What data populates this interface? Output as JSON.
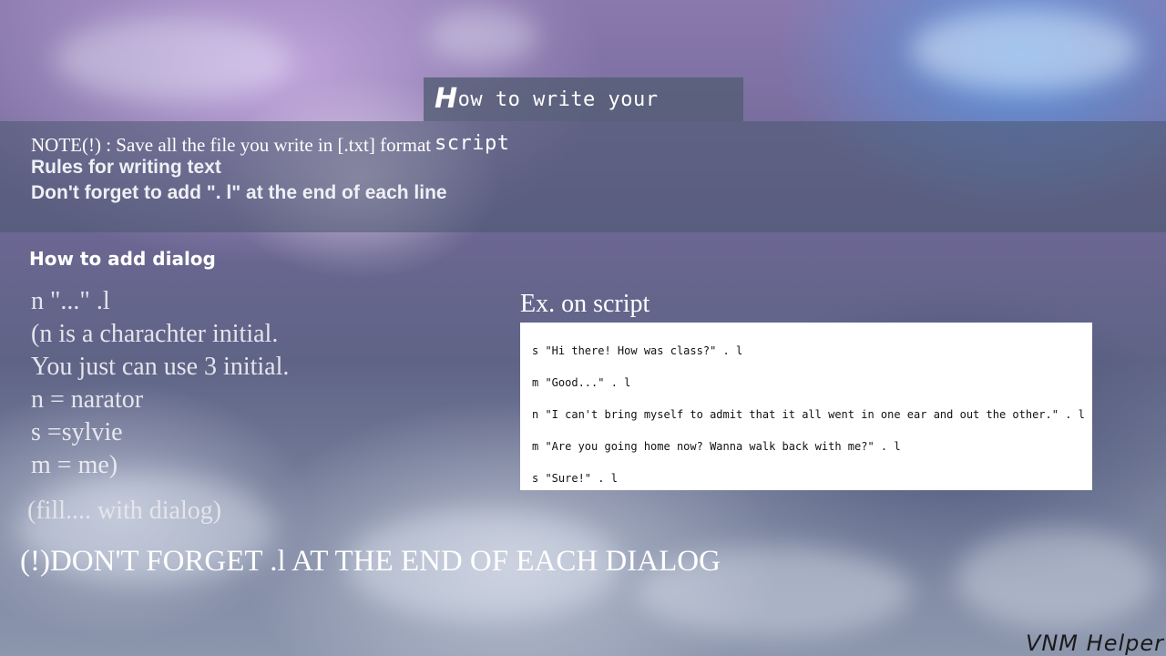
{
  "header": {
    "title_first_letter": "H",
    "title_rest": "ow to write your script"
  },
  "notes": {
    "note": "NOTE(!) : Save all the file you write in [.txt] format",
    "rule_heading": "Rules for writing text",
    "rule_line": "Don't forget to add \". l\" at the end of each line"
  },
  "dialog_section": {
    "heading": "How to add dialog",
    "lines": [
      "n \"...\" .l",
      "(n is a charachter initial.",
      "You just can use 3 initial.",
      "n = narator",
      "s =sylvie",
      "m = me)"
    ],
    "fill_hint": "(fill.... with dialog)",
    "warning": "(!)DON'T FORGET .l AT THE END OF EACH DIALOG"
  },
  "example": {
    "title": "Ex. on script",
    "lines": [
      "s \"Hi there! How was class?\" . l",
      "m \"Good...\" . l",
      "n \"I can't bring myself to admit that it all went in one ear and out the other.\" . l",
      "m \"Are you going home now? Wanna walk back with me?\" . l",
      "s \"Sure!\" . l"
    ]
  },
  "footer": {
    "brand": "VNM Helper"
  }
}
